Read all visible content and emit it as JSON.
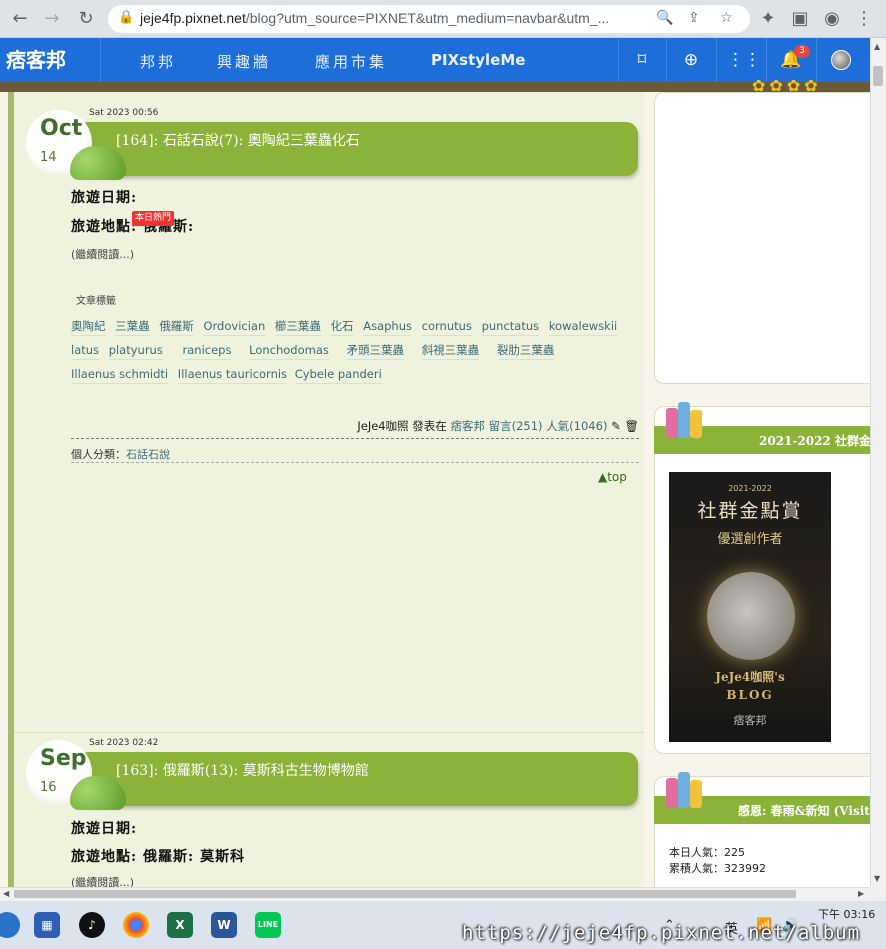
{
  "browser": {
    "url_host": "jeje4fp.pixnet.net",
    "url_path": "/blog?utm_source=PIXNET&utm_medium=navbar&utm_..."
  },
  "pixnet_nav": {
    "logo": "痞客邦",
    "links": [
      "邦邦",
      "興趣牆",
      "應用市集",
      "PIXstyleMe"
    ],
    "notification_count": "3"
  },
  "posts": [
    {
      "time": "Sat 2023 00:56",
      "month": "Oct",
      "day": "14",
      "title": "[164]: 石話石說(7): 奧陶紀三葉蟲化石",
      "travel_date_label": "旅遊日期:",
      "travel_place_label": "旅遊地點: 俄羅斯:",
      "hot_badge": "本日熱門",
      "more": "(繼續閱讀...)",
      "tags_heading": "文章標籤",
      "tags": [
        "奧陶紀",
        "三葉蟲",
        "俄羅斯",
        "Ordovician",
        "櫛三葉蟲",
        "化石",
        "Asaphus",
        "cornutus",
        "punctatus",
        "kowalewskii",
        "latus",
        "platyurus",
        "raniceps",
        "Lonchodomas",
        "矛頭三葉蟲",
        "斜視三葉蟲",
        "裂肋三葉蟲",
        "Illaenus schmidti",
        "Illaenus tauricornis",
        "Cybele panderi"
      ],
      "meta_author": "JeJe4咖照",
      "meta_posted_at": "發表在",
      "meta_site": "痞客邦",
      "meta_comments": "留言(251)",
      "meta_views": "人氣(1046)",
      "category_label": "個人分類：",
      "category": "石話石說",
      "top": "▲top"
    },
    {
      "time": "Sat 2023 02:42",
      "month": "Sep",
      "day": "16",
      "title": "[163]: 俄羅斯(13): 莫斯科古生物博物館",
      "travel_date_label": "旅遊日期:",
      "travel_place_label": "旅遊地點: 俄羅斯: 莫斯科",
      "more": "(繼續閱讀...)"
    }
  ],
  "sidebar": {
    "award_header": "2021-2022 社群金",
    "award_image": {
      "year": "2021-2022",
      "title": "社群金點賞",
      "subtitle": "優選創作者",
      "blog_name": "JeJe4咖照's",
      "blog_word": "BLOG",
      "brand": "痞客邦"
    },
    "thanks_header": "感恩: 春雨&新知 (Visitor",
    "today_views": "本日人氣：225",
    "total_views": "累積人氣：323992"
  },
  "taskbar": {
    "ime": "英",
    "time": "下午 03:16"
  },
  "watermark": "https://jeje4fp.pixnet.net/album"
}
